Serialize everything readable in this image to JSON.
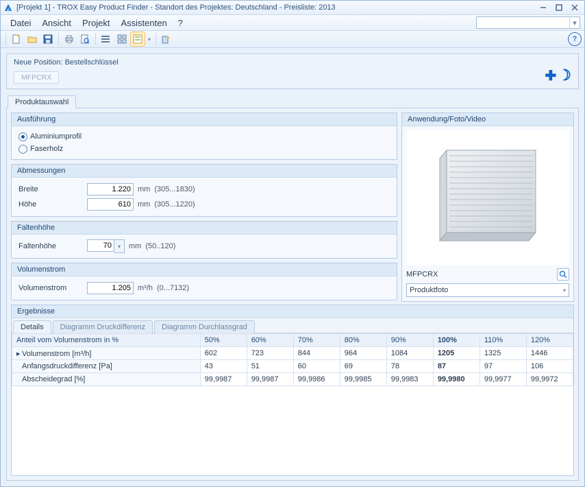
{
  "window": {
    "title": "[Projekt 1] - TROX Easy Product Finder - Standort des Projektes: Deutschland - Preisliste: 2013"
  },
  "menu": {
    "file": "Datei",
    "view": "Ansicht",
    "project": "Projekt",
    "assistants": "Assistenten",
    "help": "?"
  },
  "position": {
    "label": "Neue Position: Bestellschlüssel",
    "code": "MFPCRX"
  },
  "tabs": {
    "productselection": "Produktauswahl"
  },
  "groups": {
    "execution": {
      "title": "Ausführung",
      "opt1": "Aluminiumprofil",
      "opt2": "Faserholz"
    },
    "dimensions": {
      "title": "Abmessungen",
      "width_label": "Breite",
      "width_value": "1.220",
      "width_unit": "mm",
      "width_hint": "(305...1830)",
      "height_label": "Höhe",
      "height_value": "610",
      "height_unit": "mm",
      "height_hint": "(305...1220)"
    },
    "fold": {
      "title": "Faltenhöhe",
      "label": "Faltenhöhe",
      "value": "70",
      "unit": "mm",
      "hint": "(50..120)"
    },
    "flow": {
      "title": "Volumenstrom",
      "label": "Volumenstrom",
      "value": "1.205",
      "unit": "m³/h",
      "hint": "(0...7132)"
    }
  },
  "preview": {
    "title": "Anwendung/Foto/Video",
    "caption": "MFPCRX",
    "select": "Produktfoto"
  },
  "results": {
    "title": "Ergebnisse",
    "subtabs": {
      "details": "Details",
      "diag_dp": "Diagramm Druckdifferenz",
      "diag_dg": "Diagramm Durchlassgrad"
    },
    "header_first": "Anteil vom Volumenstrom in %",
    "percent_cols": [
      "50%",
      "60%",
      "70%",
      "80%",
      "90%",
      "100%",
      "110%",
      "120%"
    ],
    "rows": [
      {
        "label": "Volumenstrom [m³/h]",
        "vals": [
          "602",
          "723",
          "844",
          "964",
          "1084",
          "1205",
          "1325",
          "1446"
        ]
      },
      {
        "label": "Anfangsdruckdifferenz [Pa]",
        "vals": [
          "43",
          "51",
          "60",
          "69",
          "78",
          "87",
          "97",
          "106"
        ]
      },
      {
        "label": "Abscheidegrad [%]",
        "vals": [
          "99,9987",
          "99,9987",
          "99,9986",
          "99,9985",
          "99,9983",
          "99,9980",
          "99,9977",
          "99,9972"
        ]
      }
    ]
  }
}
